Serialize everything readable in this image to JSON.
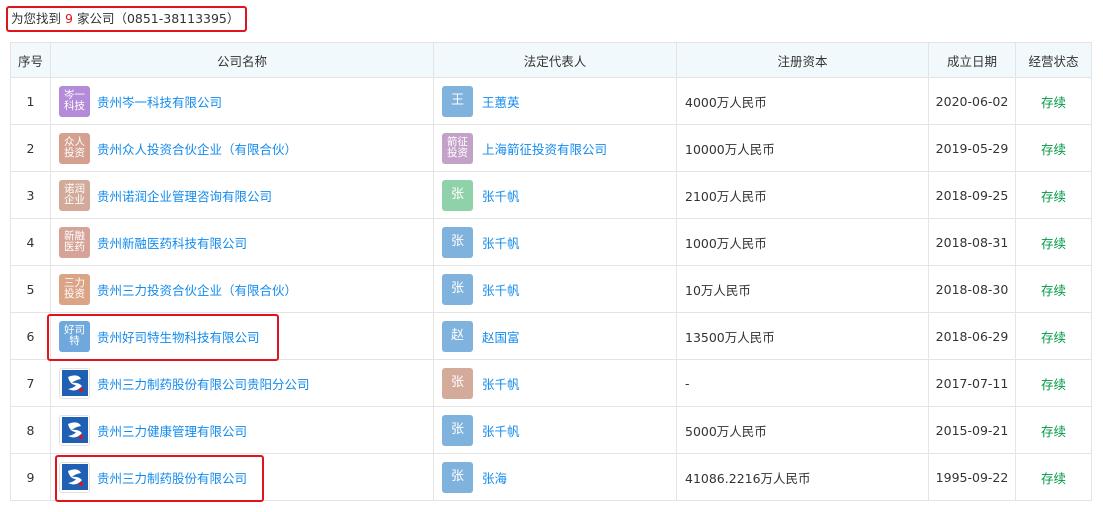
{
  "summary": {
    "prefix": "为您找到",
    "count": "9",
    "suffix": "家公司（0851-38113395）"
  },
  "headers": {
    "index": "序号",
    "company": "公司名称",
    "legal_rep": "法定代表人",
    "capital": "注册资本",
    "founded": "成立日期",
    "status": "经营状态"
  },
  "rows": [
    {
      "index": "1",
      "logo_text": "岑一科技",
      "logo_color": "#b38bd8",
      "company": "贵州岑一科技有限公司",
      "rep_avatar": "王",
      "rep_color": "#7fb2dc",
      "rep": "王蕙英",
      "capital": "4000万人民币",
      "founded": "2020-06-02",
      "status": "存续"
    },
    {
      "index": "2",
      "logo_text": "众人投资",
      "logo_color": "#d4a090",
      "company": "贵州众人投资合伙企业（有限合伙）",
      "rep_avatar": "箭征投资",
      "rep_color": "#c4a1c9",
      "rep": "上海箭征投资有限公司",
      "capital": "10000万人民币",
      "founded": "2019-05-29",
      "status": "存续"
    },
    {
      "index": "3",
      "logo_text": "诺润企业",
      "logo_color": "#d1aa9a",
      "company": "贵州诺润企业管理咨询有限公司",
      "rep_avatar": "张",
      "rep_color": "#8fd1a8",
      "rep": "张千帆",
      "capital": "2100万人民币",
      "founded": "2018-09-25",
      "status": "存续"
    },
    {
      "index": "4",
      "logo_text": "新融医药",
      "logo_color": "#d6a398",
      "company": "贵州新融医药科技有限公司",
      "rep_avatar": "张",
      "rep_color": "#7fb2dc",
      "rep": "张千帆",
      "capital": "1000万人民币",
      "founded": "2018-08-31",
      "status": "存续"
    },
    {
      "index": "5",
      "logo_text": "三力投资",
      "logo_color": "#dba486",
      "company": "贵州三力投资合伙企业（有限合伙）",
      "rep_avatar": "张",
      "rep_color": "#7fb2dc",
      "rep": "张千帆",
      "capital": "10万人民币",
      "founded": "2018-08-30",
      "status": "存续"
    },
    {
      "index": "6",
      "logo_text": "好司特",
      "logo_color": "#6ea8dc",
      "company": "贵州好司特生物科技有限公司",
      "rep_avatar": "赵",
      "rep_color": "#7fb2dc",
      "rep": "赵国富",
      "capital": "13500万人民币",
      "founded": "2018-06-29",
      "status": "存续"
    },
    {
      "index": "7",
      "logo_text": "",
      "logo_color": "brand",
      "company": "贵州三力制药股份有限公司贵阳分公司",
      "rep_avatar": "张",
      "rep_color": "#d4ab9b",
      "rep": "张千帆",
      "capital": "-",
      "founded": "2017-07-11",
      "status": "存续"
    },
    {
      "index": "8",
      "logo_text": "",
      "logo_color": "brand",
      "company": "贵州三力健康管理有限公司",
      "rep_avatar": "张",
      "rep_color": "#7fb2dc",
      "rep": "张千帆",
      "capital": "5000万人民币",
      "founded": "2015-09-21",
      "status": "存续"
    },
    {
      "index": "9",
      "logo_text": "",
      "logo_color": "brand",
      "company": "贵州三力制药股份有限公司",
      "rep_avatar": "张",
      "rep_color": "#7fb2dc",
      "rep": "张海",
      "capital": "41086.2216万人民币",
      "founded": "1995-09-22",
      "status": "存续"
    }
  ],
  "colors": {
    "link": "#128bed",
    "status_active": "#009944",
    "highlight": "#e0141a",
    "header_bg": "#f2f9fc",
    "brand_logo_blue": "#1f5fb4"
  }
}
